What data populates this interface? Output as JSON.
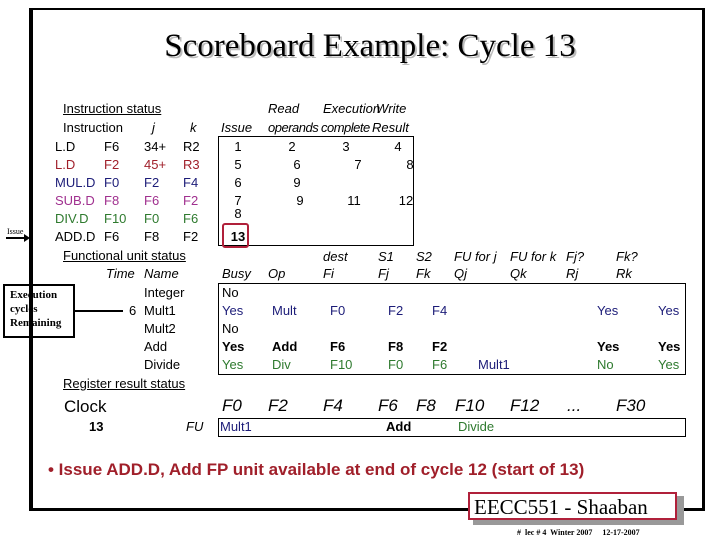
{
  "title": "Scoreboard Example:  Cycle 13",
  "colors": {
    "ld2": "#a01f2a",
    "muld": "#1c1c78",
    "subd": "#a0308f",
    "divd": "#2e7a2e",
    "highlight": "#b0203a"
  },
  "instruction_status": {
    "heading": "Instruction status",
    "col_instruction": "Instruction",
    "col_j": "j",
    "col_k": "k",
    "col_issue": "Issue",
    "col_read_1": "Read",
    "col_read_2": "operands",
    "col_exec_1": "Execution",
    "col_exec_2": "complete",
    "col_write_1": "Write",
    "col_write_2": "Result",
    "rows": [
      {
        "op": "L.D",
        "dest": "F6",
        "j": "34+",
        "k": "R2",
        "issue": "1",
        "read": "2",
        "exec": "3",
        "write": "4"
      },
      {
        "op": "L.D",
        "dest": "F2",
        "j": "45+",
        "k": "R3",
        "issue": "5",
        "read": "6",
        "exec": "7",
        "write": "8"
      },
      {
        "op": "MUL.D",
        "dest": "F0",
        "j": "F2",
        "k": "F4",
        "issue": "6",
        "read": "9",
        "exec": "",
        "write": ""
      },
      {
        "op": "SUB.D",
        "dest": "F8",
        "j": "F6",
        "k": "F2",
        "issue": "7",
        "read": "9",
        "exec": "11",
        "write": "12"
      },
      {
        "op": "DIV.D",
        "dest": "F10",
        "j": "F0",
        "k": "F6",
        "issue": "8",
        "read": "",
        "exec": "",
        "write": ""
      },
      {
        "op": "ADD.D",
        "dest": "F6",
        "j": "F8",
        "k": "F2",
        "issue": "13",
        "read": "",
        "exec": "",
        "write": ""
      }
    ],
    "issue_pointer": "Issue"
  },
  "functional_unit_status": {
    "heading": "Functional unit status",
    "hdr_top": {
      "dest": "dest",
      "s1": "S1",
      "s2": "S2",
      "fuj": "FU for j",
      "fuk": "FU for k",
      "fjq": "Fj?",
      "fkq": "Fk?"
    },
    "hdr": {
      "time": "Time",
      "name": "Name",
      "busy": "Busy",
      "op": "Op",
      "fi": "Fi",
      "fj": "Fj",
      "fk": "Fk",
      "qj": "Qj",
      "qk": "Qk",
      "rj": "Rj",
      "rk": "Rk"
    },
    "rows": [
      {
        "time": "",
        "name": "Integer",
        "busy": "No",
        "op": "",
        "fi": "",
        "fj": "",
        "fk": "",
        "qj": "",
        "qk": "",
        "rj": "",
        "rk": ""
      },
      {
        "time": "6",
        "name": "Mult1",
        "busy": "Yes",
        "op": "Mult",
        "fi": "F0",
        "fj": "F2",
        "fk": "F4",
        "qj": "",
        "qk": "",
        "rj": "Yes",
        "rk": "Yes"
      },
      {
        "time": "",
        "name": "Mult2",
        "busy": "No",
        "op": "",
        "fi": "",
        "fj": "",
        "fk": "",
        "qj": "",
        "qk": "",
        "rj": "",
        "rk": ""
      },
      {
        "time": "",
        "name": "Add",
        "busy": "Yes",
        "op": "Add",
        "fi": "F6",
        "fj": "F8",
        "fk": "F2",
        "qj": "",
        "qk": "",
        "rj": "Yes",
        "rk": "Yes"
      },
      {
        "time": "",
        "name": "Divide",
        "busy": "Yes",
        "op": "Div",
        "fi": "F10",
        "fj": "F0",
        "fk": "F6",
        "qj": "Mult1",
        "qk": "",
        "rj": "No",
        "rk": "Yes"
      }
    ],
    "callout": [
      "Execution",
      "cycles",
      "Remaining"
    ]
  },
  "register_result_status": {
    "heading": "Register result status",
    "clock_label": "Clock",
    "clock_value": "13",
    "fu_label": "FU",
    "registers": [
      "F0",
      "F2",
      "F4",
      "F6",
      "F8",
      "F10",
      "F12",
      "...",
      "F30"
    ],
    "fu": [
      "Mult1",
      "",
      "",
      "Add",
      "",
      "Divide",
      "",
      "",
      ""
    ]
  },
  "bullet": "• Issue ADD.D,  Add FP unit available at end of cycle 12 (start of 13)",
  "footer": {
    "course": "EECC551 - Shaaban",
    "info": "#  lec # 4  Winter 2007     12-17-2007"
  }
}
